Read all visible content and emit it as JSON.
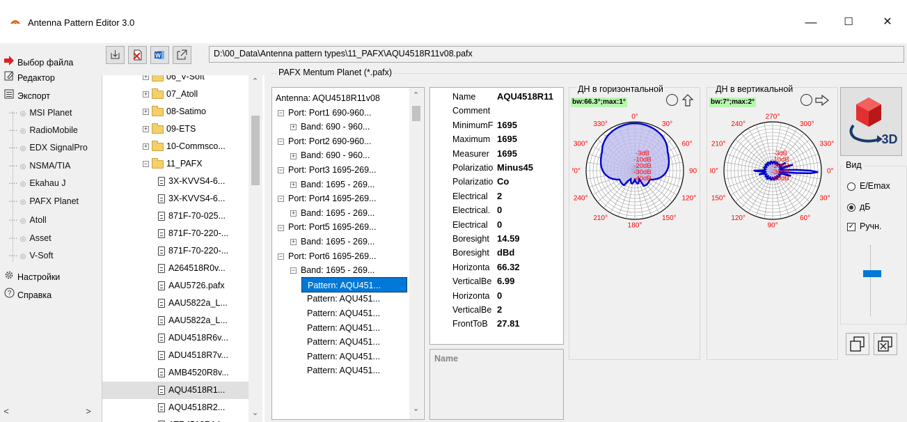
{
  "window": {
    "title": "Antenna Pattern Editor 3.0",
    "minimize": "—",
    "maximize": "☐",
    "close": "✕"
  },
  "nav": {
    "items": [
      {
        "label": "Выбор файла",
        "icon": "arrow-right-icon"
      },
      {
        "label": "Редактор",
        "icon": "edit-icon"
      },
      {
        "label": "Экспорт",
        "icon": "list-icon"
      }
    ],
    "export_items": [
      "MSI Planet",
      "RadioMobile",
      "EDX SignalPro",
      "NSMA/TIA",
      "Ekahau J",
      "PAFX Planet",
      "Atoll",
      "Asset",
      "V-Soft"
    ],
    "bottom_items": [
      {
        "label": "Настройки",
        "icon": "gear-icon"
      },
      {
        "label": "Справка",
        "icon": "help-icon"
      }
    ]
  },
  "toolbar": {
    "path": "D:\\00_Data\\Antenna pattern types\\11_PAFX\\AQU4518R11v08.pafx"
  },
  "file_tree": {
    "rows": [
      {
        "type": "folder",
        "label": "06_V-Soft",
        "expanded": false,
        "indent": 1
      },
      {
        "type": "folder",
        "label": "07_Atoll",
        "expanded": false,
        "indent": 1
      },
      {
        "type": "folder",
        "label": "08-Satimo",
        "expanded": false,
        "indent": 1
      },
      {
        "type": "folder",
        "label": "09-ETS",
        "expanded": false,
        "indent": 1
      },
      {
        "type": "folder",
        "label": "10-Commsco...",
        "expanded": false,
        "indent": 1
      },
      {
        "type": "folder",
        "label": "11_PAFX",
        "expanded": true,
        "indent": 1
      },
      {
        "type": "file",
        "label": "3X-KVVS4-6...",
        "indent": 2
      },
      {
        "type": "file",
        "label": "3X-KVVS4-6...",
        "indent": 2
      },
      {
        "type": "file",
        "label": "871F-70-025...",
        "indent": 2
      },
      {
        "type": "file",
        "label": "871F-70-220-...",
        "indent": 2
      },
      {
        "type": "file",
        "label": "871F-70-220-...",
        "indent": 2
      },
      {
        "type": "file",
        "label": "A264518R0v...",
        "indent": 2
      },
      {
        "type": "file",
        "label": "AAU5726.pafx",
        "indent": 2
      },
      {
        "type": "file",
        "label": "AAU5822a_L...",
        "indent": 2
      },
      {
        "type": "file",
        "label": "AAU5822a_L...",
        "indent": 2
      },
      {
        "type": "file",
        "label": "ADU4518R6v...",
        "indent": 2
      },
      {
        "type": "file",
        "label": "ADU4518R7v...",
        "indent": 2
      },
      {
        "type": "file",
        "label": "AMB4520R8v...",
        "indent": 2
      },
      {
        "type": "file",
        "label": "AQU4518R1...",
        "indent": 2,
        "selected": true
      },
      {
        "type": "file",
        "label": "AQU4518R2...",
        "indent": 2
      },
      {
        "type": "file",
        "label": "ATR4518R14...",
        "indent": 2
      }
    ]
  },
  "group_title": "PAFX Mentum Planet (*.pafx)",
  "port_tree": {
    "rows": [
      {
        "label": "Antenna: AQU4518R11v08",
        "indent": 0,
        "toggle": ""
      },
      {
        "label": "Port: Port1 690-960...",
        "indent": 1,
        "toggle": "−"
      },
      {
        "label": "Band: 690 - 960...",
        "indent": 2,
        "toggle": "+"
      },
      {
        "label": "Port: Port2 690-960...",
        "indent": 1,
        "toggle": "−"
      },
      {
        "label": "Band: 690 - 960...",
        "indent": 2,
        "toggle": "+"
      },
      {
        "label": "Port: Port3 1695-269...",
        "indent": 1,
        "toggle": "−"
      },
      {
        "label": "Band: 1695 - 269...",
        "indent": 2,
        "toggle": "+"
      },
      {
        "label": "Port: Port4 1695-269...",
        "indent": 1,
        "toggle": "−"
      },
      {
        "label": "Band: 1695 - 269...",
        "indent": 2,
        "toggle": "+"
      },
      {
        "label": "Port: Port5 1695-269...",
        "indent": 1,
        "toggle": "−"
      },
      {
        "label": "Band: 1695 - 269...",
        "indent": 2,
        "toggle": "+"
      },
      {
        "label": "Port: Port6 1695-269...",
        "indent": 1,
        "toggle": "−"
      },
      {
        "label": "Band: 1695 - 269...",
        "indent": 2,
        "toggle": "−"
      },
      {
        "label": "Pattern: AQU451...",
        "indent": 3,
        "toggle": "",
        "selected": true
      },
      {
        "label": "Pattern: AQU451...",
        "indent": 3,
        "toggle": ""
      },
      {
        "label": "Pattern: AQU451...",
        "indent": 3,
        "toggle": ""
      },
      {
        "label": "Pattern: AQU451...",
        "indent": 3,
        "toggle": ""
      },
      {
        "label": "Pattern: AQU451...",
        "indent": 3,
        "toggle": ""
      },
      {
        "label": "Pattern: AQU451...",
        "indent": 3,
        "toggle": ""
      },
      {
        "label": "Pattern: AQU451...",
        "indent": 3,
        "toggle": ""
      }
    ]
  },
  "properties": [
    {
      "name": "Name",
      "value": "AQU4518R11"
    },
    {
      "name": "Comment",
      "value": ""
    },
    {
      "name": "MinimumF",
      "value": "1695"
    },
    {
      "name": "Maximum",
      "value": "1695"
    },
    {
      "name": "Measurer",
      "value": "1695"
    },
    {
      "name": "Polarizatio",
      "value": "Minus45"
    },
    {
      "name": "Polarizatio",
      "value": "Co"
    },
    {
      "name": "Electrical",
      "value": "2"
    },
    {
      "name": "Electrical.",
      "value": "0"
    },
    {
      "name": "Electrical",
      "value": "0"
    },
    {
      "name": "Boresight",
      "value": "14.59"
    },
    {
      "name": "Boresight",
      "value": "dBd"
    },
    {
      "name": "Horizonta",
      "value": "66.32"
    },
    {
      "name": "VerticalBe",
      "value": "6.99"
    },
    {
      "name": "Horizonta",
      "value": "0"
    },
    {
      "name": "VerticalBe",
      "value": "2"
    },
    {
      "name": "FrontToB",
      "value": "27.81"
    }
  ],
  "description": {
    "label": "Name"
  },
  "horizontal_panel": {
    "title": "ДН в горизонтальной",
    "bw": "bw:66.3°;max:1°",
    "angles": [
      "0°",
      "30°",
      "60°",
      "90°",
      "120°",
      "150°",
      "180°",
      "210°",
      "240°",
      "270°",
      "300°",
      "330°"
    ],
    "rings": [
      "-3dB",
      "-10dB",
      "-20dB",
      "-30dB",
      "-40dB"
    ]
  },
  "vertical_panel": {
    "title": "ДН в вертикальной",
    "bw": "bw:7°;max:2°",
    "angles": [
      "270°",
      "300°",
      "330°",
      "0°",
      "30°",
      "60°",
      "90°",
      "120°",
      "150°",
      "180°",
      "210°",
      "240°"
    ],
    "rings": [
      "-3dB",
      "-10dB",
      "-20dB",
      "-30dB",
      "-40dB"
    ]
  },
  "view_panel": {
    "btn3d_label": "3D",
    "title": "Вид",
    "opt_emax": "E/Emax",
    "opt_db": "дБ",
    "opt_manual": "Ручн.",
    "selected": "db",
    "manual_checked": true
  },
  "colors": {
    "ring_label": "#ff0000",
    "pattern": "#0000cc",
    "pattern_fill": "#b8b8ee",
    "bw_bg": "#b8f5b0",
    "selection": "#0078d7",
    "slider": "#0078d7"
  }
}
